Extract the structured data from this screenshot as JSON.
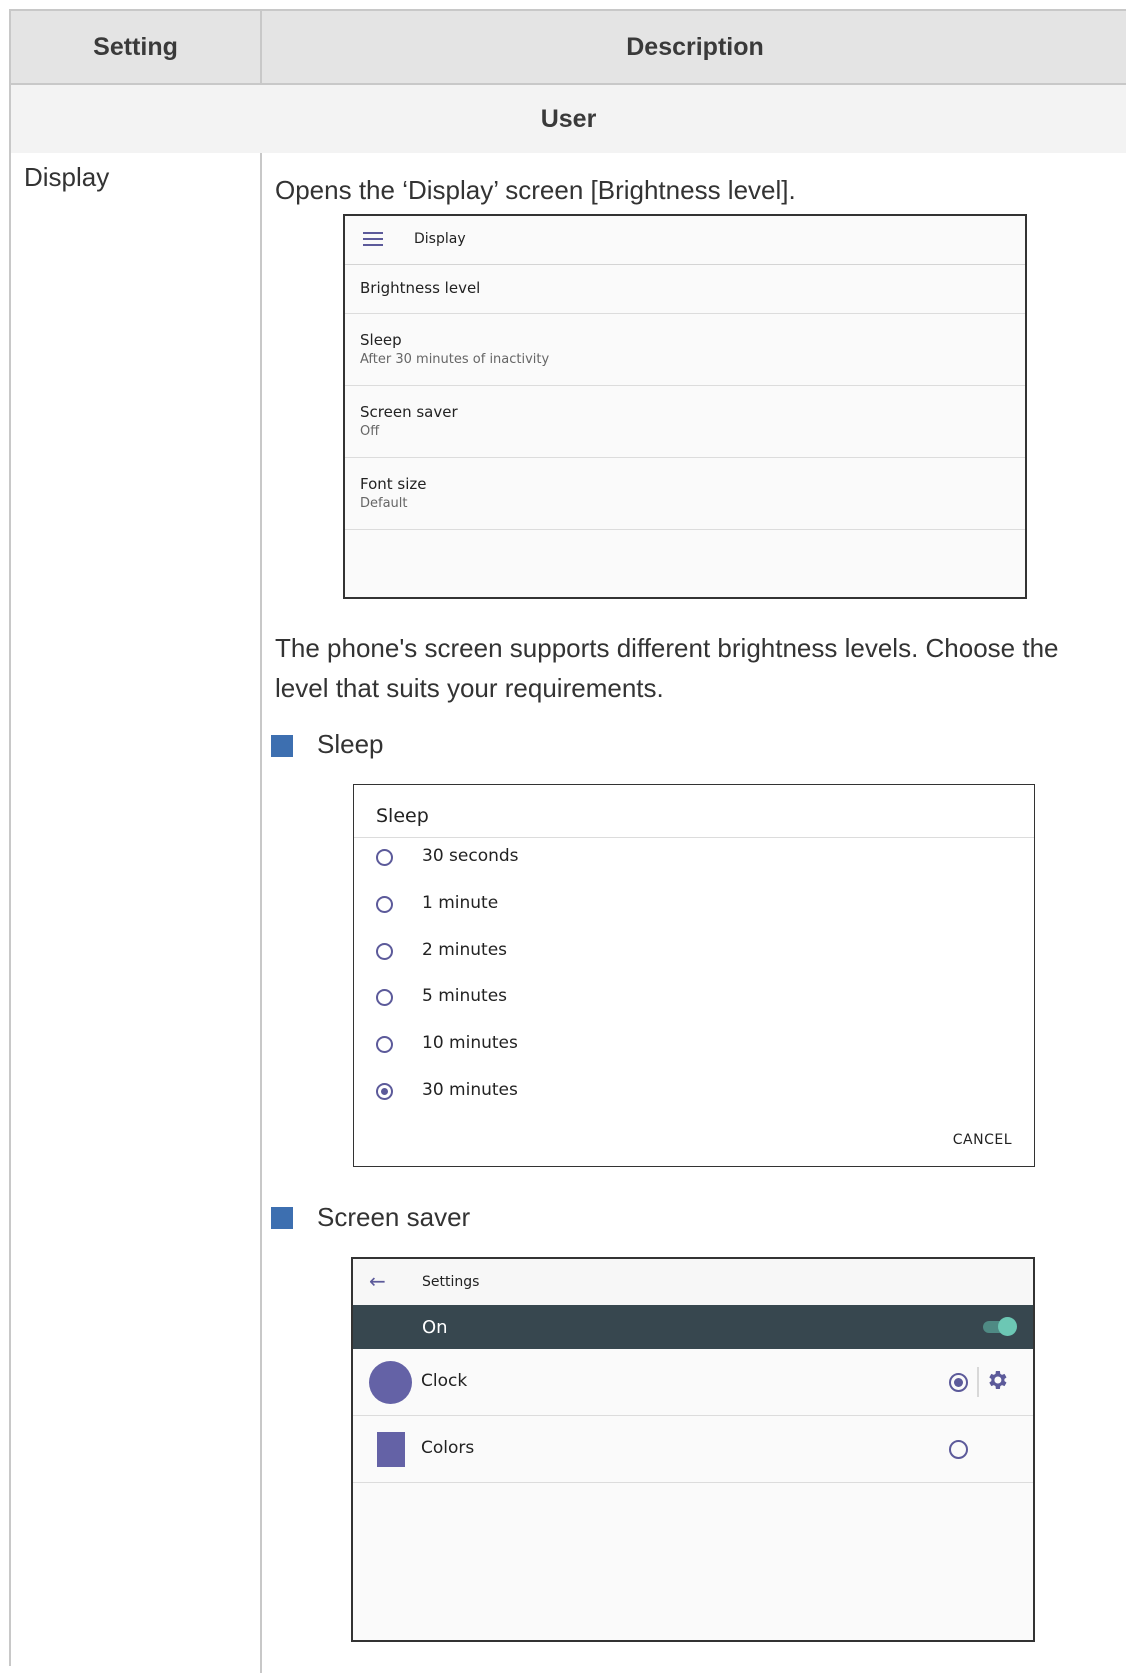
{
  "table": {
    "header_setting": "Setting",
    "header_description": "Description",
    "section": "User",
    "row_setting": "Display",
    "intro": "Opens the ‘Display’ screen [Brightness level].",
    "brightness_text_1": "The phone's screen supports different brightness levels. Choose the",
    "brightness_text_2": "level that suits your requirements.",
    "bullet_sleep": "Sleep",
    "bullet_screensaver": "Screen saver"
  },
  "display_screen": {
    "title": "Display",
    "icon": "menu-icon",
    "items": [
      {
        "title": "Brightness level",
        "subtitle": ""
      },
      {
        "title": "Sleep",
        "subtitle": "After 30 minutes of inactivity"
      },
      {
        "title": "Screen saver",
        "subtitle": "Off"
      },
      {
        "title": "Font size",
        "subtitle": "Default"
      }
    ]
  },
  "sleep_dialog": {
    "title": "Sleep",
    "options": [
      "30 seconds",
      "1 minute",
      "2 minutes",
      "5 minutes",
      "10 minutes",
      "30 minutes"
    ],
    "selected": "30 minutes",
    "cancel_label": "CANCEL"
  },
  "screensaver_screen": {
    "title": "Settings",
    "toggle_label": "On",
    "toggle_on": true,
    "items": [
      {
        "label": "Clock",
        "selected": true,
        "has_settings": true
      },
      {
        "label": "Colors",
        "selected": false,
        "has_settings": false
      }
    ]
  },
  "colors": {
    "accent": "#5c5a9a",
    "header_bg": "#37474f",
    "toggle": "#6cc7b4",
    "bullet": "#3d6fb0"
  }
}
